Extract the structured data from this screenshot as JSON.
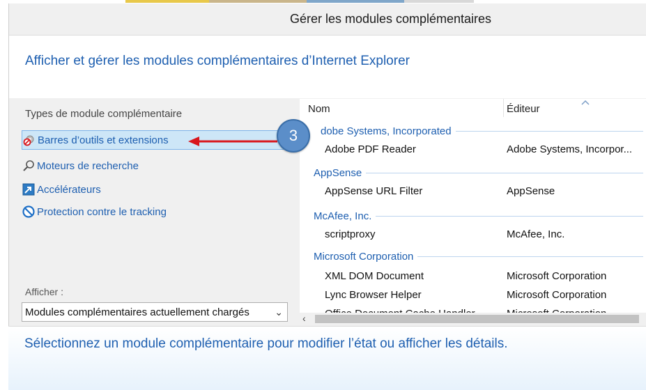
{
  "window": {
    "title": "Gérer les modules complémentaires"
  },
  "header": {
    "heading": "Afficher et gérer les modules complémentaires d’Internet Explorer"
  },
  "sidebar": {
    "types_label": "Types de module complémentaire",
    "categories": [
      {
        "label": "Barres d’outils et extensions",
        "icon": "gear-blocked-icon",
        "selected": true
      },
      {
        "label": "Moteurs de recherche",
        "icon": "search-icon",
        "selected": false
      },
      {
        "label": "Accélérateurs",
        "icon": "accelerator-icon",
        "selected": false
      },
      {
        "label": "Protection contre le tracking",
        "icon": "tracking-protection-icon",
        "selected": false
      }
    ],
    "afficher_label": "Afficher :",
    "dropdown_value": "Modules complémentaires actuellement chargés"
  },
  "annotation": {
    "badge_number": "3",
    "accent": "#d9161c"
  },
  "list": {
    "columns": [
      "Nom",
      "Éditeur"
    ],
    "groups": [
      {
        "name": "Adobe Systems, Incorporated",
        "name_visible": "dobe Systems, Incorporated",
        "rows": [
          {
            "name": "Adobe PDF Reader",
            "publisher": "Adobe Systems, Incorpor..."
          }
        ]
      },
      {
        "name": "AppSense",
        "rows": [
          {
            "name": "AppSense URL Filter",
            "publisher": "AppSense"
          }
        ]
      },
      {
        "name": "McAfee, Inc.",
        "rows": [
          {
            "name": "scriptproxy",
            "publisher": "McAfee, Inc."
          }
        ]
      },
      {
        "name": "Microsoft Corporation",
        "rows": [
          {
            "name": "XML DOM Document",
            "publisher": "Microsoft Corporation"
          },
          {
            "name": "Lync Browser Helper",
            "publisher": "Microsoft Corporation"
          },
          {
            "name": "Office Document Cache Handler",
            "publisher": "Microsoft Corporation"
          }
        ]
      }
    ]
  },
  "details": {
    "message": "Sélectionnez un module complémentaire pour modifier l’état ou afficher les détails."
  },
  "colors": {
    "link_blue": "#1e5fb0",
    "selection_bg": "#cde6f7",
    "badge_blue": "#5b8ec9"
  }
}
